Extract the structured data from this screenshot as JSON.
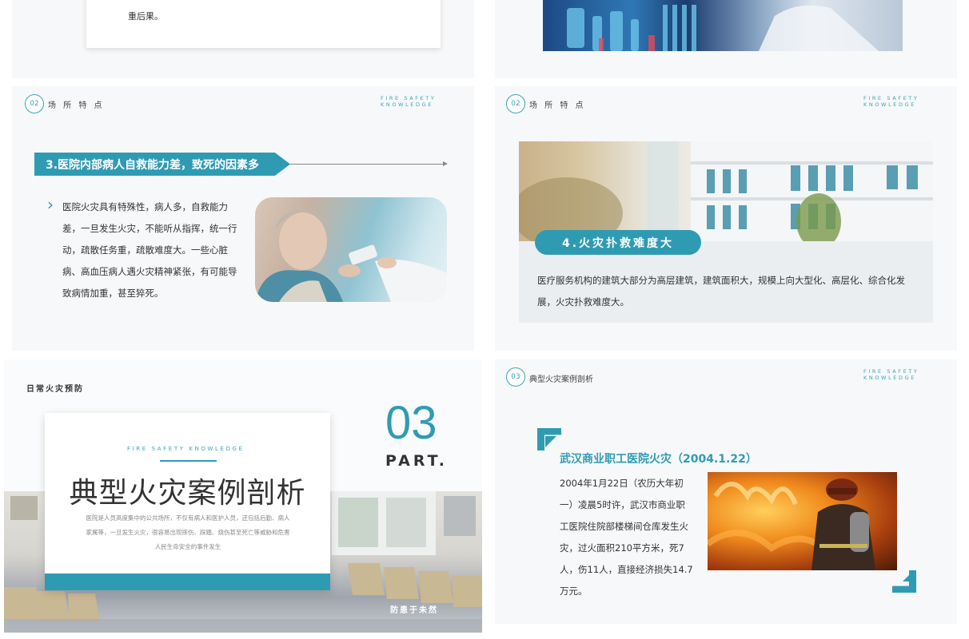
{
  "slide_top_left": {
    "text_end": "重后果。"
  },
  "slide_mid_left": {
    "badge": "02",
    "section": "场 所 特 点",
    "tag": "FIRE SAFETY KNOWLEDGE",
    "heading": "3.医院内部病人自救能力差，致死的因素多",
    "body": "医院火灾具有特殊性，病人多，自救能力差，一旦发生火灾，不能听从指挥，统一行动，疏散任务重，疏散难度大。一些心脏病、高血压病人遇火灾精神紧张，有可能导致病情加重，甚至猝死。"
  },
  "slide_mid_right": {
    "badge": "02",
    "section": "场 所 特 点",
    "tag": "FIRE SAFETY KNOWLEDGE",
    "heading": "4.火灾扑救难度大",
    "body": "医疗服务机构的建筑大部分为高层建筑，建筑面积大，规模上向大型化、高层化、综合化发展，火灾扑救难度大。"
  },
  "slide_bot_left": {
    "corner": "日常火灾预防",
    "tag": "FIRE SAFETY KNOWLEDGE",
    "title": "典型火灾案例剖析",
    "desc_lines": [
      "医院是人员高度集中的公共场所，不仅有病人和医护人员，还包括后勤、病人",
      "家属等，一旦发生火灾，很容易出现摔伤、踩踏、烧伤甚至死亡等威胁和危害",
      "人民生命安全的事件发生"
    ],
    "number": "03",
    "part": "PART.",
    "motto": "防患于未然"
  },
  "slide_bot_right": {
    "badge": "03",
    "section": "典型火灾案例剖析",
    "tag": "FIRE SAFETY KNOWLEDGE",
    "heading": "武汉商业职工医院火灾（2004.1.22）",
    "body": "2004年1月22日（农历大年初一）凌晨5时许，武汉市商业职工医院住院部楼梯间仓库发生火灾，过火面积210平方米，死7人，伤11人，直接经济损失14.7万元。"
  }
}
